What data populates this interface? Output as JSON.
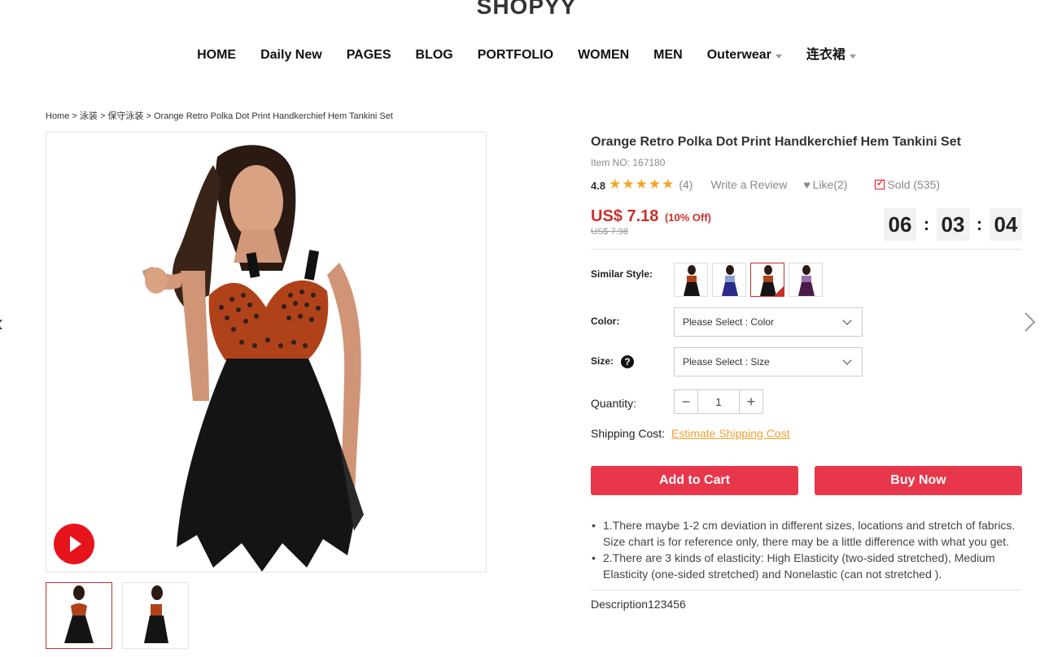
{
  "site": {
    "logo": "SHOPYY"
  },
  "nav": {
    "items": [
      {
        "label": "HOME",
        "has_dropdown": false
      },
      {
        "label": "Daily New",
        "has_dropdown": false
      },
      {
        "label": "PAGES",
        "has_dropdown": false
      },
      {
        "label": "BLOG",
        "has_dropdown": false
      },
      {
        "label": "PORTFOLIO",
        "has_dropdown": false
      },
      {
        "label": "WOMEN",
        "has_dropdown": false
      },
      {
        "label": "MEN",
        "has_dropdown": false
      },
      {
        "label": "Outerwear",
        "has_dropdown": true
      },
      {
        "label": "连衣裙",
        "has_dropdown": true
      }
    ]
  },
  "breadcrumb": {
    "home": "Home",
    "sep": " > ",
    "cat1": "泳装",
    "cat2": "保守泳装",
    "current": "Orange Retro Polka Dot Print Handkerchief Hem Tankini Set"
  },
  "gallery": {
    "play_icon": "play-icon",
    "prev_icon": "chevron-left-icon",
    "next_icon": "chevron-right-icon",
    "active_thumb": 0,
    "thumb_count": 2
  },
  "product": {
    "title": "Orange Retro Polka Dot Print Handkerchief Hem Tankini Set",
    "item_no": "Item NO: 167180",
    "rating": "4.8",
    "stars": 5,
    "review_count": "(4)",
    "write_review": "Write a Review",
    "like": "Like(2)",
    "sold": "Sold (535)",
    "price": "US$ 7.18",
    "discount": "(10% Off)",
    "old_price": "US$ 7.98",
    "accent_color": "#c9302c",
    "star_color": "#f5a623"
  },
  "countdown": {
    "hours": "06",
    "minutes": "03",
    "seconds": "04",
    "sep": ":"
  },
  "options": {
    "similar_label": "Similar Style:",
    "similar_swatches": [
      "orange",
      "blue",
      "orange-selected",
      "purple"
    ],
    "selected_swatch": 2,
    "color_label": "Color:",
    "color_placeholder": "Please Select : Color",
    "size_label": "Size:",
    "size_placeholder": "Please Select : Size",
    "qty_label": "Quantity:",
    "qty_value": "1",
    "qty_minus": "−",
    "qty_plus": "+",
    "shipping_label": "Shipping Cost:",
    "shipping_link": "Estimate Shipping Cost"
  },
  "actions": {
    "add_to_cart": "Add to Cart",
    "buy_now": "Buy Now",
    "button_color": "#e8374a"
  },
  "notes": [
    "1.There maybe 1-2 cm deviation in different sizes, locations and stretch of fabrics. Size chart is for reference only, there may be a little difference with what you get.",
    "2.There are 3 kinds of elasticity: High Elasticity (two-sided stretched), Medium Elasticity (one-sided stretched) and Nonelastic (can not stretched )."
  ],
  "description_tab": "Description123456"
}
